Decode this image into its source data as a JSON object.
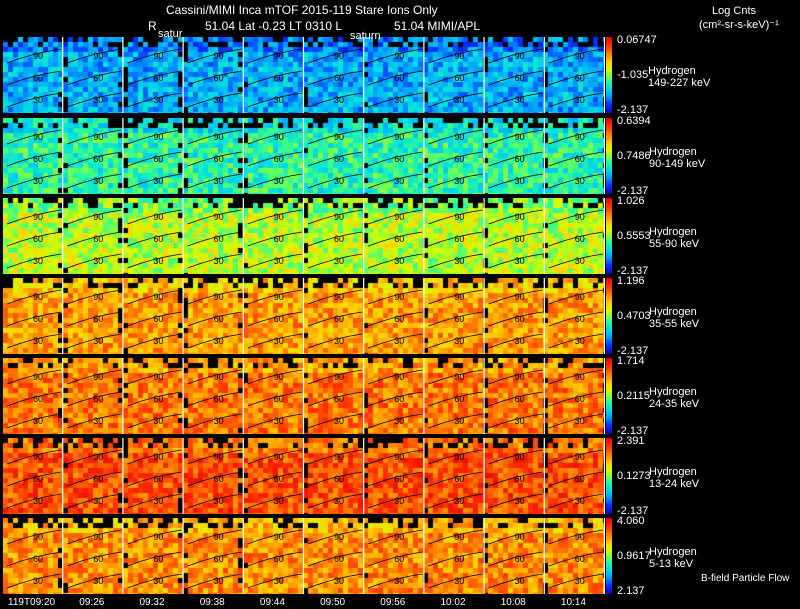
{
  "header": {
    "title": "Cassini/MIMI Inca mTOF  2015-119   Stare   Ions Only",
    "line2_left": "R",
    "line2_mid": "51.04 Lat -0.23 LT 0310 L",
    "line2_right": "51.04  MIMI/APL",
    "saturn_label": "satur",
    "saturn_label2": "saturn"
  },
  "colorbar_title": {
    "line1": "Log Cnts",
    "line2": "(cm²-sr-s-keV)⁻¹"
  },
  "footer": {
    "bfield_label": "B-field Particle Flow",
    "time_labels": [
      "119T09:20",
      "09:26",
      "09:32",
      "09:38",
      "09:44",
      "09:50",
      "09:56",
      "10:02",
      "10:08",
      "10:14"
    ]
  },
  "grid_labels": [
    "90",
    "60",
    "30",
    "120"
  ],
  "colors": {
    "background": "#000000",
    "colormap": [
      "#1a00b0",
      "#0030ff",
      "#00a0ff",
      "#00e0e0",
      "#40ff80",
      "#d0ff00",
      "#ffd000",
      "#ff8000",
      "#ff3000",
      "#e00000"
    ]
  },
  "chart_data": {
    "type": "heatmap",
    "species": "Hydrogen",
    "x_labels": [
      "119T09:20",
      "09:26",
      "09:32",
      "09:38",
      "09:44",
      "09:50",
      "09:56",
      "10:02",
      "10:08",
      "10:14"
    ],
    "panels": [
      {
        "name": "Hydrogen",
        "energy": "149-227 keV",
        "max": "0.06747",
        "mid": "-1.035",
        "min": "-2.137",
        "level": 0.25
      },
      {
        "name": "Hydrogen",
        "energy": "90-149 keV",
        "max": "0.6394",
        "mid": "0.7486",
        "min": "-2.137",
        "level": 0.4
      },
      {
        "name": "Hydrogen",
        "energy": "55-90 keV",
        "max": "1.026",
        "mid": "0.5553",
        "min": "-2.137",
        "level": 0.55
      },
      {
        "name": "Hydrogen",
        "energy": "35-55 keV",
        "max": "1.196",
        "mid": "0.4703",
        "min": "-2.137",
        "level": 0.74
      },
      {
        "name": "Hydrogen",
        "energy": "24-35 keV",
        "max": "1.714",
        "mid": "0.2115",
        "min": "-2.137",
        "level": 0.79
      },
      {
        "name": "Hydrogen",
        "energy": "13-24 keV",
        "max": "2.391",
        "mid": "0.1273",
        "min": "-2.137",
        "level": 0.85
      },
      {
        "name": "Hydrogen",
        "energy": "5-13 keV",
        "max": "4.060",
        "mid": "0.9617",
        "min": "2.137",
        "level": 0.76
      }
    ]
  }
}
